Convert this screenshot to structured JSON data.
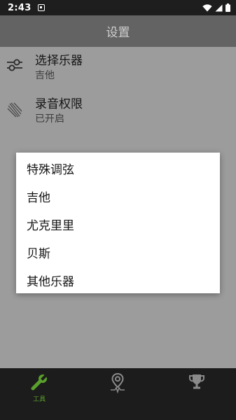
{
  "status_bar": {
    "time": "2:43",
    "icons": [
      "app-notification-icon",
      "wifi-icon",
      "signal-icon",
      "battery-icon"
    ]
  },
  "app_bar": {
    "title": "设置"
  },
  "settings": [
    {
      "title": "选择乐器",
      "subtitle": "吉他",
      "icon": "sliders-icon"
    },
    {
      "title": "录音权限",
      "subtitle": "已开启",
      "icon": "microphone-permission-icon"
    }
  ],
  "dialog": {
    "options": [
      "特殊调弦",
      "吉他",
      "尤克里里",
      "贝斯",
      "其他乐器"
    ]
  },
  "bottom_nav": {
    "items": [
      {
        "icon": "wrench-icon",
        "label": "工具",
        "active": true
      },
      {
        "icon": "location-pin-icon",
        "active": false
      },
      {
        "icon": "trophy-icon",
        "active": false
      }
    ],
    "active_color": "#5aa02c",
    "inactive_color": "#8a8a8a"
  },
  "colors": {
    "overlay": "#9c9c9c",
    "status_bar": "#1e1e1e",
    "nav_bar": "#1c1c1c"
  }
}
